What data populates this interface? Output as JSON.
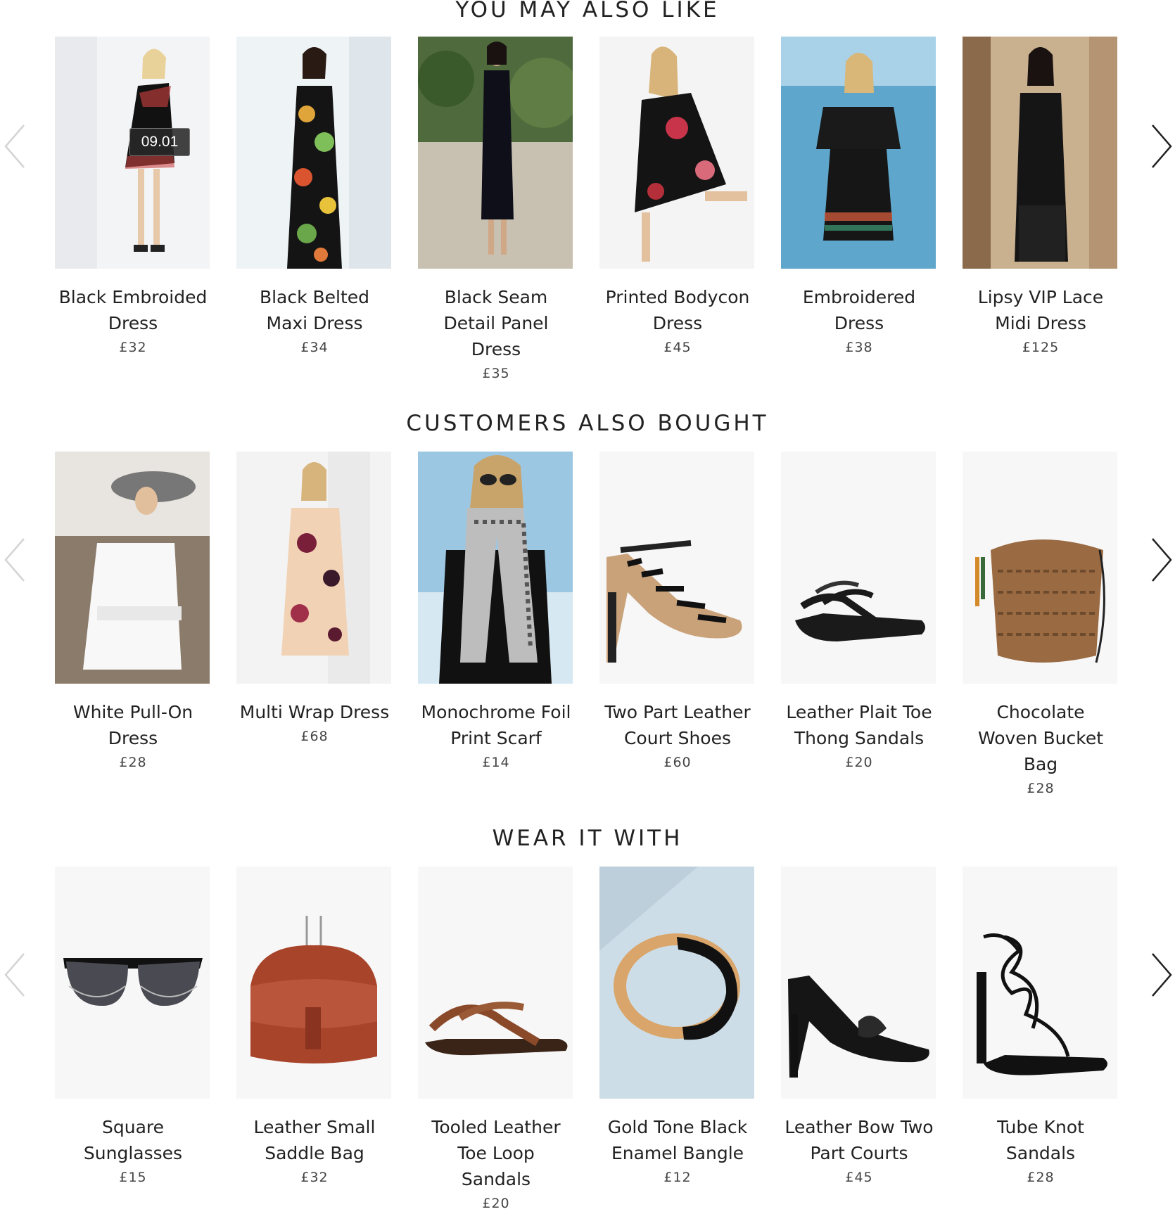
{
  "sections": [
    {
      "heading": "YOU MAY ALSO LIKE",
      "products": [
        {
          "name": "Black Embroided Dress",
          "price": "£32",
          "badge": "09.01"
        },
        {
          "name": "Black Belted Maxi Dress",
          "price": "£34"
        },
        {
          "name": "Black Seam Detail Panel Dress",
          "price": "£35"
        },
        {
          "name": "Printed Bodycon Dress",
          "price": "£45"
        },
        {
          "name": "Embroidered Dress",
          "price": "£38"
        },
        {
          "name": "Lipsy VIP Lace Midi Dress",
          "price": "£125"
        }
      ]
    },
    {
      "heading": "CUSTOMERS ALSO BOUGHT",
      "products": [
        {
          "name": "White Pull-On Dress",
          "price": "£28"
        },
        {
          "name": "Multi Wrap Dress",
          "price": "£68"
        },
        {
          "name": "Monochrome Foil Print Scarf",
          "price": "£14"
        },
        {
          "name": "Two Part Leather Court Shoes",
          "price": "£60"
        },
        {
          "name": "Leather Plait Toe Thong Sandals",
          "price": "£20"
        },
        {
          "name": "Chocolate Woven Bucket Bag",
          "price": "£28"
        }
      ]
    },
    {
      "heading": "WEAR IT WITH",
      "products": [
        {
          "name": "Square Sunglasses",
          "price": "£15"
        },
        {
          "name": "Leather Small Saddle Bag",
          "price": "£32"
        },
        {
          "name": "Tooled Leather Toe Loop Sandals",
          "price": "£20"
        },
        {
          "name": "Gold Tone Black Enamel Bangle",
          "price": "£12"
        },
        {
          "name": "Leather Bow Two Part Courts",
          "price": "£45"
        },
        {
          "name": "Tube Knot Sandals",
          "price": "£28"
        }
      ]
    }
  ]
}
